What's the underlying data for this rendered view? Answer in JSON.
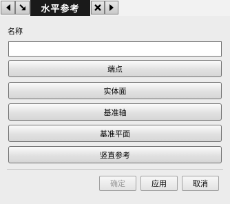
{
  "tab": {
    "title": "水平参考"
  },
  "form": {
    "name_label": "名称",
    "name_value": "",
    "options": [
      "端点",
      "实体面",
      "基准轴",
      "基准平面",
      "竖直参考"
    ]
  },
  "dialog": {
    "ok_label": "确定",
    "apply_label": "应用",
    "cancel_label": "取消"
  }
}
